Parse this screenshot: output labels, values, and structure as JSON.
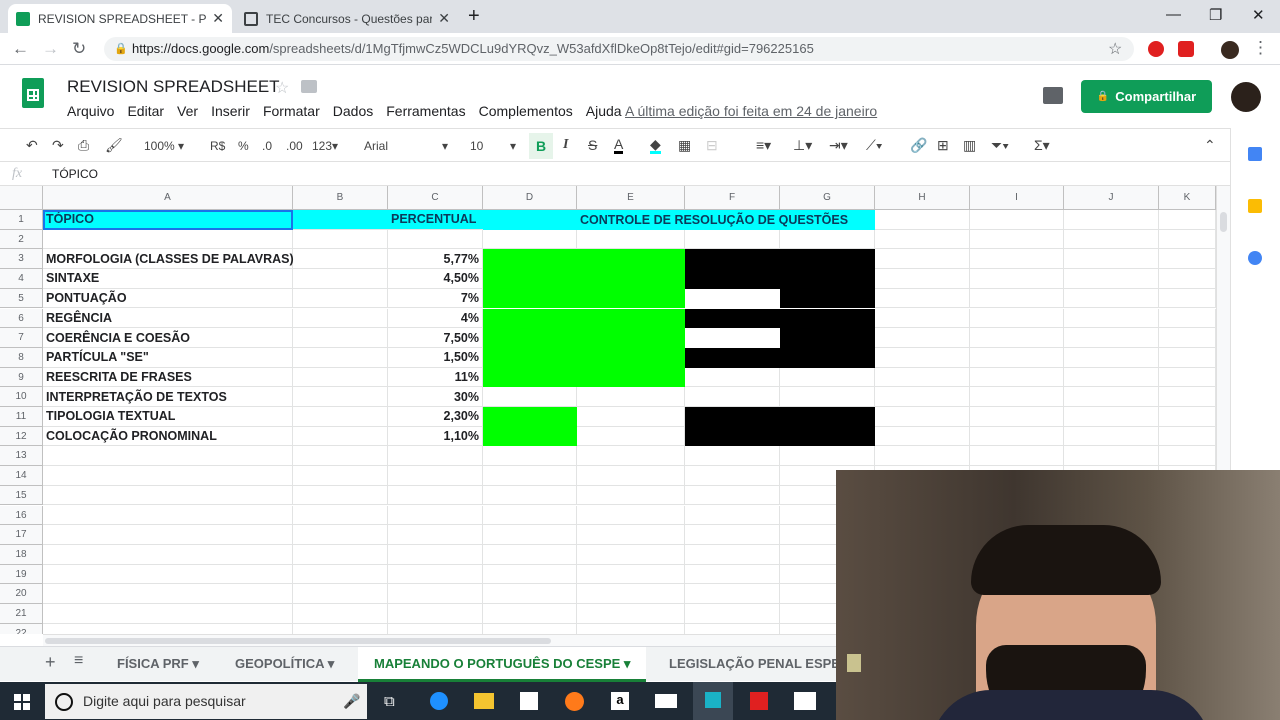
{
  "browser": {
    "tabs": [
      {
        "label": "REVISION SPREADSHEET - Planil",
        "active": true
      },
      {
        "label": "TEC Concursos - Questões para c",
        "active": false
      }
    ],
    "url_host": "https://docs.google.com",
    "url_path": "/spreadsheets/d/1MgTfjmwCz5WDCLu9dYRQvz_W53afdXflDkeOp8tTejo/edit#gid=796225165"
  },
  "doc": {
    "title": "REVISION SPREADSHEET",
    "menus": [
      "Arquivo",
      "Editar",
      "Ver",
      "Inserir",
      "Formatar",
      "Dados",
      "Ferramentas",
      "Complementos",
      "Ajuda"
    ],
    "last_edit": "A última edição foi feita em 24 de janeiro",
    "share_label": "Compartilhar"
  },
  "toolbar": {
    "zoom": "100%",
    "currency": "R$",
    "percent": "%",
    "dec_less": ".0",
    "dec_more": ".00",
    "format_more": "123",
    "font": "Arial",
    "font_size": "10",
    "bold": "B",
    "italic": "I",
    "strike": "S",
    "textcolor": "A",
    "sigma": "Σ"
  },
  "formula": {
    "fx": "fx",
    "value": "TÓPICO"
  },
  "columns": [
    "A",
    "B",
    "C",
    "D",
    "E",
    "F",
    "G",
    "H",
    "I",
    "J",
    "K"
  ],
  "rows": [
    {
      "n": "1",
      "a": "TÓPICO",
      "c": "PERCENTUAL",
      "e": "CONTROLE DE RESOLUÇÃO DE QUESTÕES"
    },
    {
      "n": "2",
      "a": "",
      "c": ""
    },
    {
      "n": "3",
      "a": "MORFOLOGIA (CLASSES DE PALAVRAS)",
      "c": "5,77%"
    },
    {
      "n": "4",
      "a": "SINTAXE",
      "c": "4,50%"
    },
    {
      "n": "5",
      "a": "PONTUAÇÃO",
      "c": "7%"
    },
    {
      "n": "6",
      "a": "REGÊNCIA",
      "c": "4%"
    },
    {
      "n": "7",
      "a": "COERÊNCIA E COESÃO",
      "c": "7,50%"
    },
    {
      "n": "8",
      "a": "PARTÍCULA \"SE\"",
      "c": "1,50%"
    },
    {
      "n": "9",
      "a": "REESCRITA DE FRASES",
      "c": "11%"
    },
    {
      "n": "10",
      "a": "INTERPRETAÇÃO DE TEXTOS",
      "c": "30%"
    },
    {
      "n": "11",
      "a": "TIPOLOGIA TEXTUAL",
      "c": "2,30%"
    },
    {
      "n": "12",
      "a": "COLOCAÇÃO PRONOMINAL",
      "c": "1,10%"
    },
    {
      "n": "13",
      "a": "",
      "c": ""
    },
    {
      "n": "14",
      "a": "",
      "c": ""
    },
    {
      "n": "15",
      "a": "",
      "c": ""
    },
    {
      "n": "16",
      "a": "",
      "c": ""
    },
    {
      "n": "17",
      "a": "",
      "c": ""
    },
    {
      "n": "18",
      "a": "",
      "c": ""
    },
    {
      "n": "19",
      "a": "",
      "c": ""
    },
    {
      "n": "20",
      "a": "",
      "c": ""
    },
    {
      "n": "21",
      "a": "",
      "c": ""
    },
    {
      "n": "22",
      "a": "",
      "c": ""
    }
  ],
  "sheet_tabs": [
    {
      "label": "FÍSICA PRF",
      "active": false
    },
    {
      "label": "GEOPOLÍTICA",
      "active": false
    },
    {
      "label": "MAPEANDO O PORTUGUÊS DO CESPE",
      "active": true
    },
    {
      "label": "LEGISLAÇÃO PENAL ESPE",
      "active": false
    }
  ],
  "taskbar": {
    "search_placeholder": "Digite aqui para pesquisar"
  },
  "colors": {
    "header_fill": "#00ffff",
    "green_fill": "#00ff00",
    "black_fill": "#000000",
    "share_green": "#0f9d58"
  }
}
